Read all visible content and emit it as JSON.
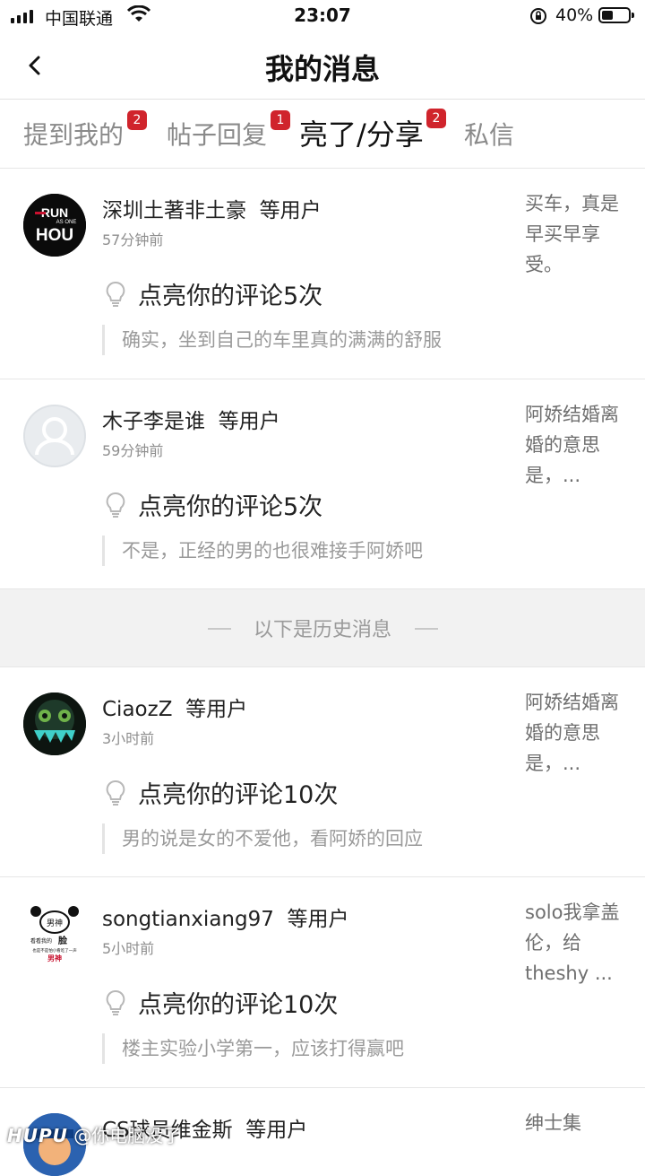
{
  "status_bar": {
    "carrier": "中国联通",
    "time": "23:07",
    "battery": "40%"
  },
  "nav": {
    "title": "我的消息"
  },
  "tabs": [
    {
      "label": "提到我的",
      "badge": "2"
    },
    {
      "label": "帖子回复",
      "badge": "1"
    },
    {
      "label": "亮了/分享",
      "badge": "2",
      "active": true
    },
    {
      "label": "私信",
      "badge": ""
    }
  ],
  "messages": [
    {
      "user": "深圳土著非土豪",
      "suffix": "等用户",
      "time": "57分钟前",
      "action": "点亮你的评论5次",
      "comment": "确实，坐到自己的车里真的满满的舒服",
      "snippet": "买车，真是早买早享受。"
    },
    {
      "user": "木子李是谁",
      "suffix": "等用户",
      "time": "59分钟前",
      "action": "点亮你的评论5次",
      "comment": "不是，正经的男的也很难接手阿娇吧",
      "snippet": "阿娇结婚离婚的意思是，..."
    },
    {
      "user": "CiaozZ",
      "suffix": "等用户",
      "time": "3小时前",
      "action": "点亮你的评论10次",
      "comment": "男的说是女的不爱他，看阿娇的回应",
      "snippet": "阿娇结婚离婚的意思是，..."
    },
    {
      "user": "songtianxiang97",
      "suffix": "等用户",
      "time": "5小时前",
      "action": "点亮你的评论10次",
      "comment": "楼主实验小学第一，应该打得赢吧",
      "snippet": "solo我拿盖伦，给theshy ..."
    },
    {
      "user": "CS球员维金斯",
      "suffix": "等用户",
      "time": "",
      "action": "",
      "comment": "",
      "snippet": "绅士集"
    }
  ],
  "history_divider": "以下是历史消息",
  "avatars": {
    "a1_top": "RUN",
    "a1_mid": "AS ONE",
    "a1_bottom": "HOU",
    "a4_top": "男神",
    "a4_line1": "看看我的",
    "a4_big": "脸",
    "a4_line2": "也是不是怕小看吃了一声",
    "a4_bottom": "男神"
  },
  "watermark": {
    "brand": "HUPU",
    "handle": "@你电脑没了"
  },
  "colors": {
    "badge": "#d0242c",
    "active_tab": "#111111",
    "inactive_tab": "#8a8a8a"
  }
}
